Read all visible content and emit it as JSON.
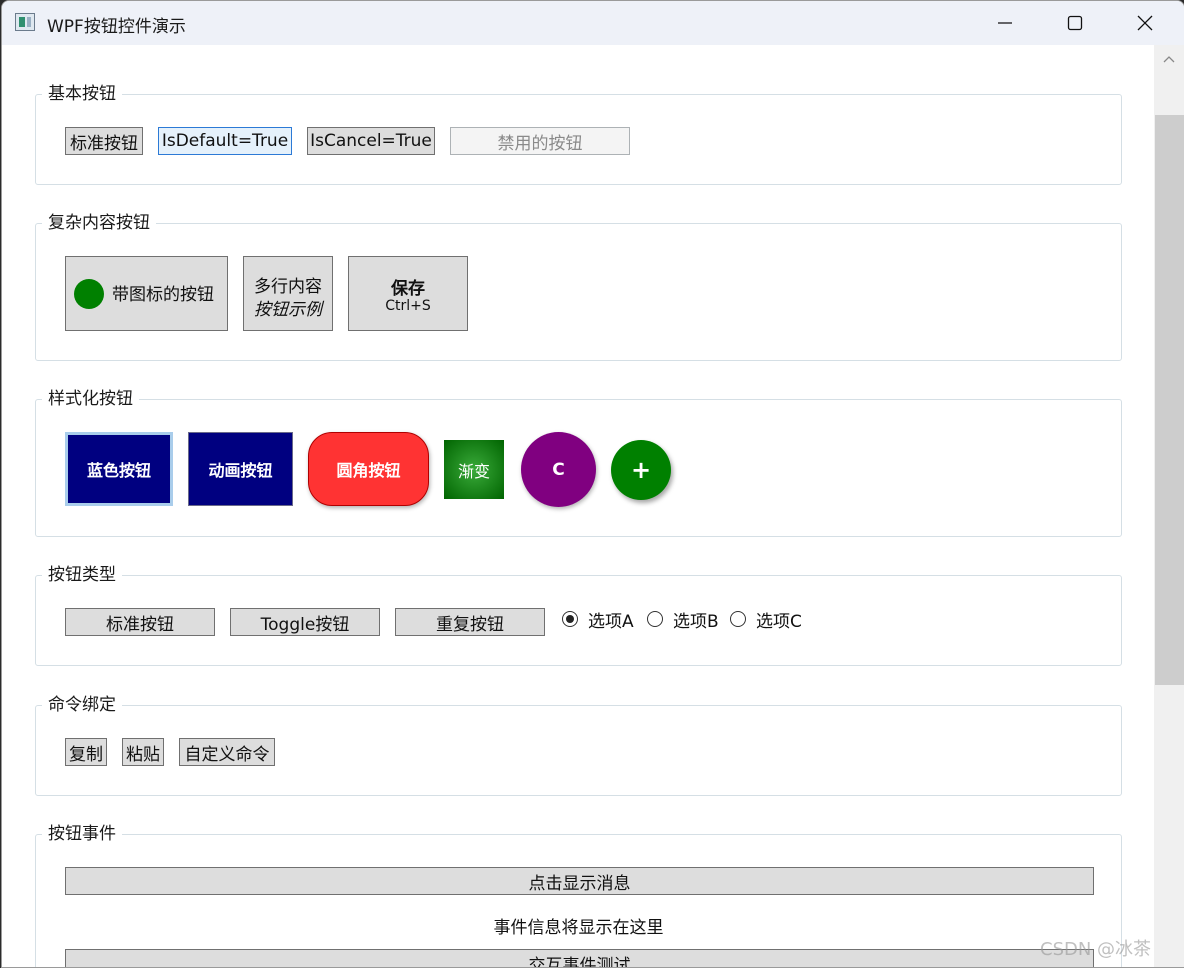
{
  "window": {
    "title": "WPF按钮控件演示"
  },
  "groups": {
    "basic": {
      "header": "基本按钮",
      "buttons": [
        "标准按钮",
        "IsDefault=True",
        "IsCancel=True",
        "禁用的按钮"
      ]
    },
    "complex": {
      "header": "复杂内容按钮",
      "icon_button_label": "带图标的按钮",
      "multiline_line1": "多行内容",
      "multiline_line2": "按钮示例",
      "save_title": "保存",
      "save_shortcut": "Ctrl+S"
    },
    "styled": {
      "header": "样式化按钮",
      "buttons": [
        "蓝色按钮",
        "动画按钮",
        "圆角按钮",
        "渐变",
        "C",
        "+"
      ]
    },
    "types": {
      "header": "按钮类型",
      "buttons": [
        "标准按钮",
        "Toggle按钮",
        "重复按钮"
      ],
      "radios": [
        "选项A",
        "选项B",
        "选项C"
      ],
      "selected_radio": "选项A"
    },
    "commands": {
      "header": "命令绑定",
      "buttons": [
        "复制",
        "粘贴",
        "自定义命令"
      ]
    },
    "events": {
      "header": "按钮事件",
      "show_message_button": "点击显示消息",
      "event_info": "事件信息将显示在这里",
      "interaction_button": "交互事件测试"
    }
  },
  "watermark": "CSDN @冰茶",
  "colors": {
    "blue_button": "#000080",
    "rounded_button": "#ff3333",
    "gradient_center": "#3aaa3a",
    "gradient_edge": "#006400",
    "circle_button": "#800080",
    "plus_button": "#008000",
    "icon_dot": "#008000"
  }
}
